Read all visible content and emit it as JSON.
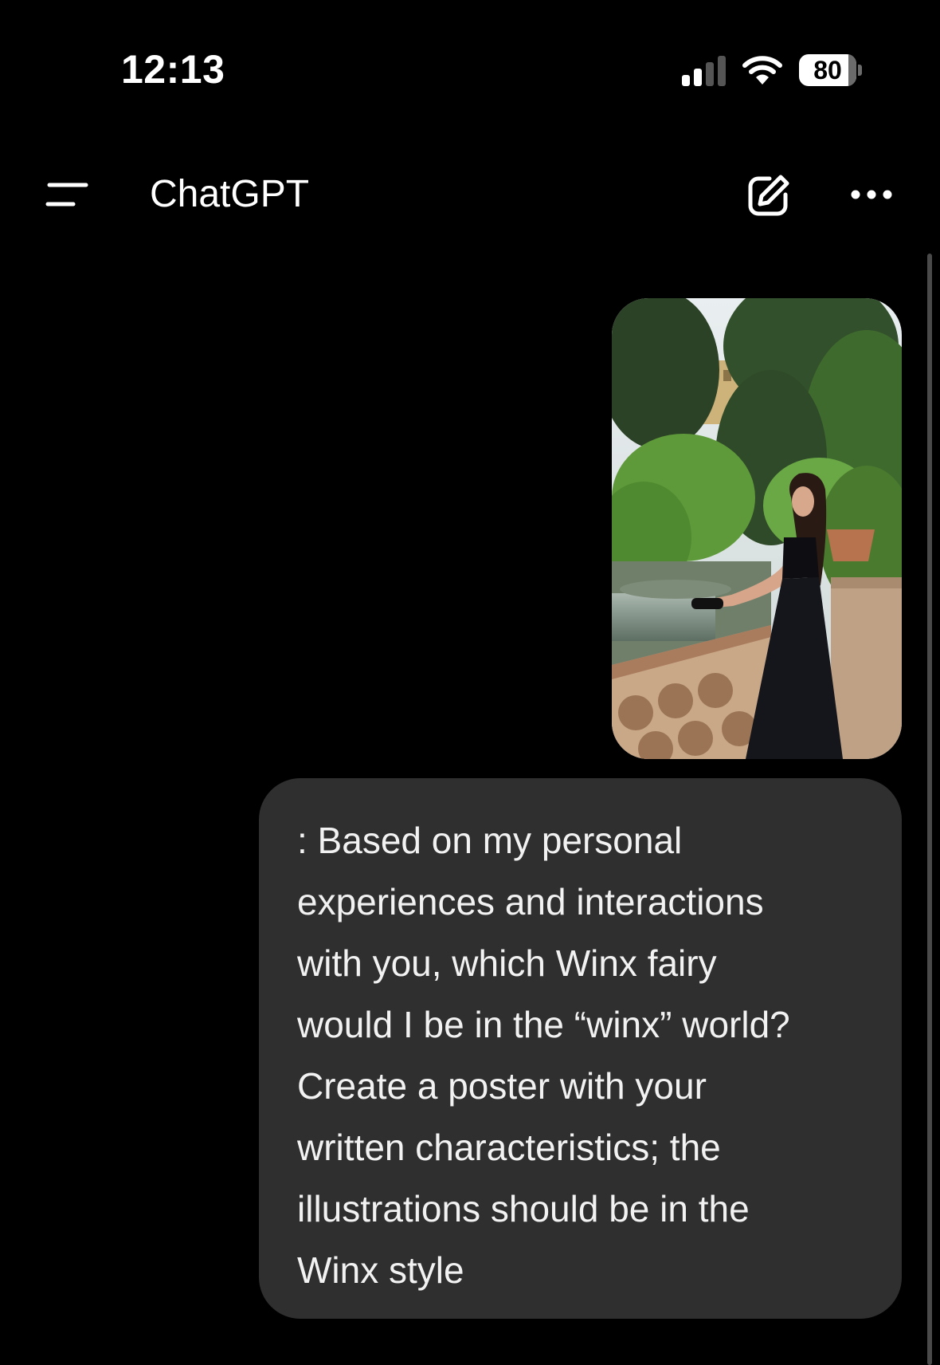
{
  "status_bar": {
    "time": "12:13",
    "battery_level": "80"
  },
  "header": {
    "title": "ChatGPT",
    "icons": [
      "menu-icon",
      "new-chat-icon",
      "more-icon"
    ]
  },
  "conversation": {
    "user_image": {
      "icon": "photo-attachment"
    },
    "user_message": ": Based on my personal\nexperiences and interactions\nwith you, which Winx fairy\nwould I be in the “winx” world?\nCreate a poster with your\nwritten characteristics; the\nillustrations should be in the\nWinx style"
  },
  "colors": {
    "background": "#000000",
    "bubble": "#2f2f2f",
    "text": "#ffffff"
  }
}
